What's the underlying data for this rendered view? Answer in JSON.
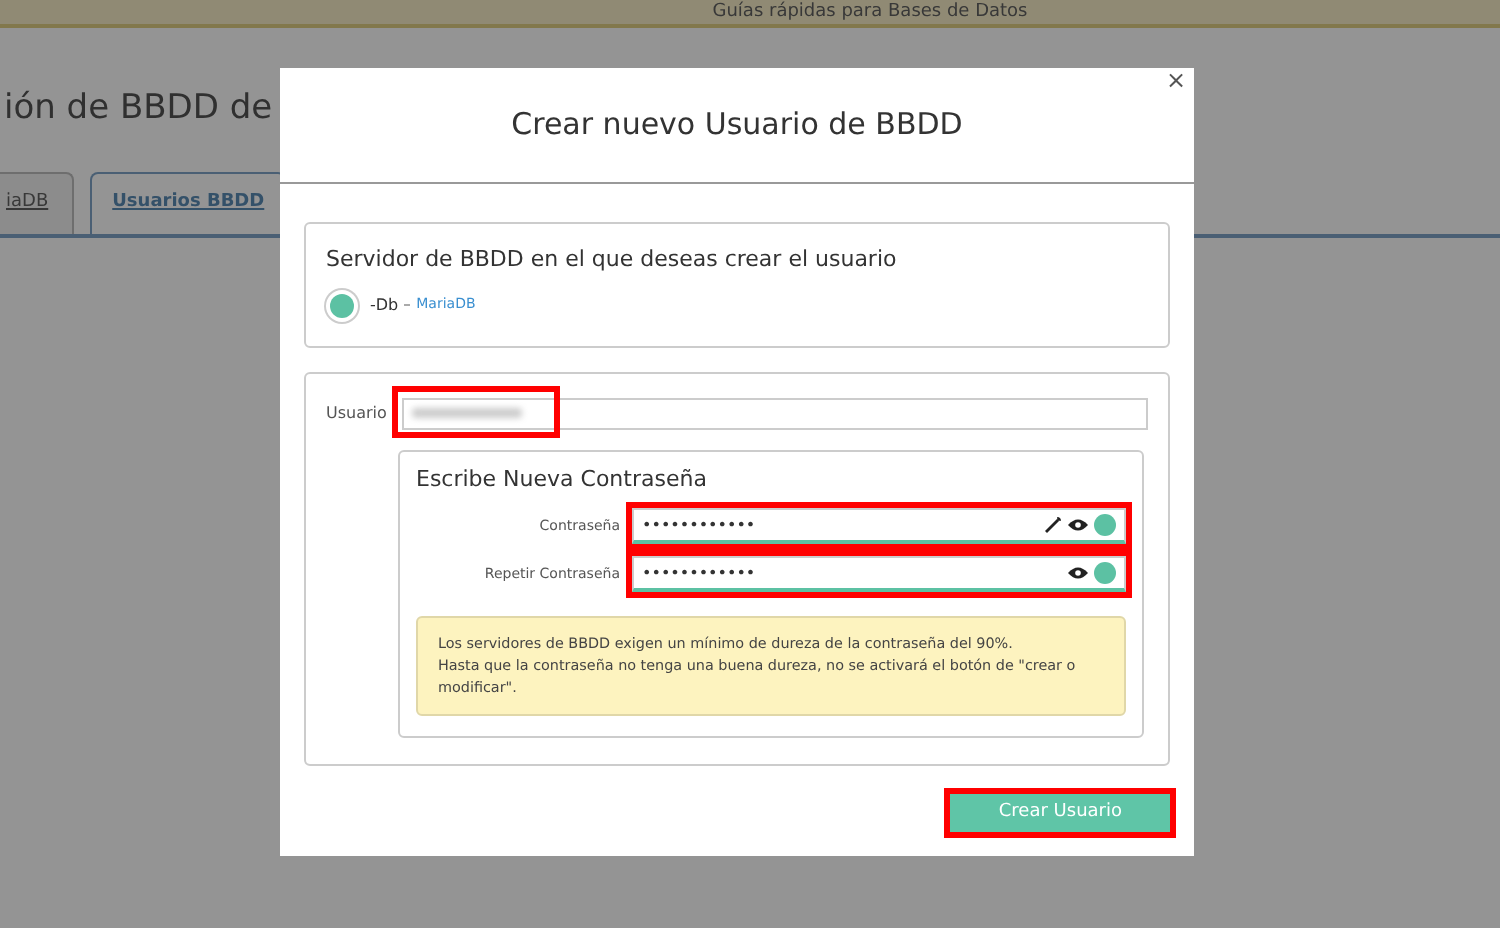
{
  "banner": {
    "text": "Guías rápidas para Bases de Datos"
  },
  "page": {
    "title": "ión de BBDD de",
    "tabs": [
      {
        "label": "iaDB",
        "selected": false
      },
      {
        "label": "Usuarios BBDD",
        "selected": true
      }
    ]
  },
  "modal": {
    "title": "Crear nuevo Usuario de BBDD",
    "close": "×",
    "server": {
      "heading": "Servidor de BBDD en el que deseas crear el usuario",
      "options": [
        {
          "name": "-Db",
          "engine": "MariaDB",
          "selected": true
        }
      ]
    },
    "user": {
      "label": "Usuario",
      "blurred": true,
      "highlighted": true
    },
    "password": {
      "heading": "Escribe Nueva Contraseña",
      "fields": [
        {
          "label": "Contraseña",
          "value": "••••••••••••",
          "generator": true,
          "valid": true,
          "highlighted": true
        },
        {
          "label": "Repetir Contraseña",
          "value": "••••••••••••",
          "generator": false,
          "valid": true,
          "highlighted": true
        }
      ],
      "notice": [
        "Los servidores de BBDD exigen un mínimo de dureza de la contraseña del 90%.",
        "Hasta que la contraseña no tenga una buena dureza, no se activará el botón de \"crear o modificar\"."
      ]
    },
    "submit": {
      "label": "Crear Usuario",
      "highlighted": true
    }
  }
}
